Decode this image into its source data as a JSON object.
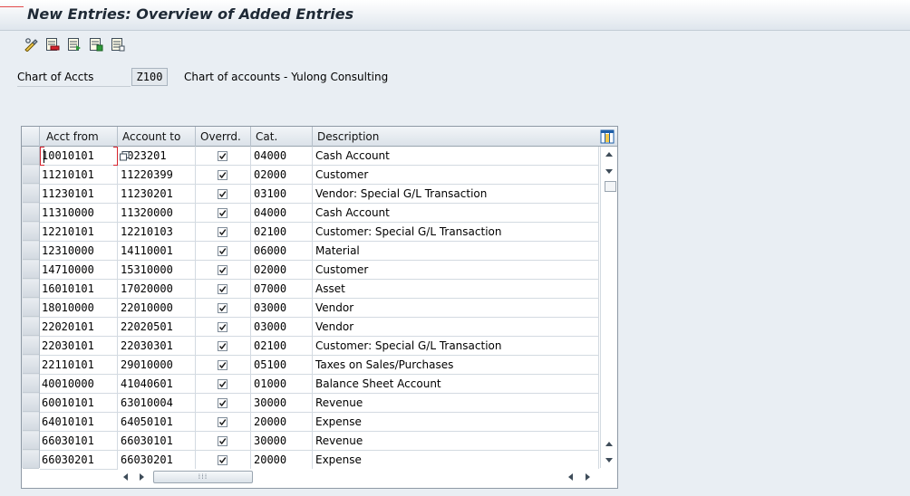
{
  "window": {
    "title": "New Entries: Overview of Added Entries"
  },
  "toolbar": {
    "buttons": [
      {
        "icon": "display-change-icon"
      },
      {
        "icon": "delete-entry-icon"
      },
      {
        "icon": "select-all-icon"
      },
      {
        "icon": "deselect-all-icon"
      },
      {
        "icon": "select-block-icon"
      }
    ]
  },
  "selection": {
    "label": "Chart of Accts",
    "value": "Z100",
    "description": "Chart of accounts - Yulong Consulting"
  },
  "table": {
    "columns": [
      "Acct from",
      "Account to",
      "Overrd.",
      "Cat.",
      "Description"
    ],
    "rows": [
      {
        "from": "10010101",
        "to": "1023201",
        "overrd": true,
        "cat": "04000",
        "desc": "Cash Account"
      },
      {
        "from": "11210101",
        "to": "11220399",
        "overrd": true,
        "cat": "02000",
        "desc": "Customer"
      },
      {
        "from": "11230101",
        "to": "11230201",
        "overrd": true,
        "cat": "03100",
        "desc": "Vendor: Special G/L Transaction"
      },
      {
        "from": "11310000",
        "to": "11320000",
        "overrd": true,
        "cat": "04000",
        "desc": "Cash Account"
      },
      {
        "from": "12210101",
        "to": "12210103",
        "overrd": true,
        "cat": "02100",
        "desc": "Customer: Special G/L Transaction"
      },
      {
        "from": "12310000",
        "to": "14110001",
        "overrd": true,
        "cat": "06000",
        "desc": "Material"
      },
      {
        "from": "14710000",
        "to": "15310000",
        "overrd": true,
        "cat": "02000",
        "desc": "Customer"
      },
      {
        "from": "16010101",
        "to": "17020000",
        "overrd": true,
        "cat": "07000",
        "desc": "Asset"
      },
      {
        "from": "18010000",
        "to": "22010000",
        "overrd": true,
        "cat": "03000",
        "desc": "Vendor"
      },
      {
        "from": "22020101",
        "to": "22020501",
        "overrd": true,
        "cat": "03000",
        "desc": "Vendor"
      },
      {
        "from": "22030101",
        "to": "22030301",
        "overrd": true,
        "cat": "02100",
        "desc": "Customer: Special G/L Transaction"
      },
      {
        "from": "22110101",
        "to": "29010000",
        "overrd": true,
        "cat": "05100",
        "desc": "Taxes on Sales/Purchases"
      },
      {
        "from": "40010000",
        "to": "41040601",
        "overrd": true,
        "cat": "01000",
        "desc": "Balance Sheet Account"
      },
      {
        "from": "60010101",
        "to": "63010004",
        "overrd": true,
        "cat": "30000",
        "desc": "Revenue"
      },
      {
        "from": "64010101",
        "to": "64050101",
        "overrd": true,
        "cat": "20000",
        "desc": "Expense"
      },
      {
        "from": "66030101",
        "to": "66030101",
        "overrd": true,
        "cat": "30000",
        "desc": "Revenue"
      },
      {
        "from": "66030201",
        "to": "66030201",
        "overrd": true,
        "cat": "20000",
        "desc": "Expense"
      }
    ]
  },
  "colors": {
    "accent_red": "#d6242e",
    "background": "#e9eef3"
  }
}
